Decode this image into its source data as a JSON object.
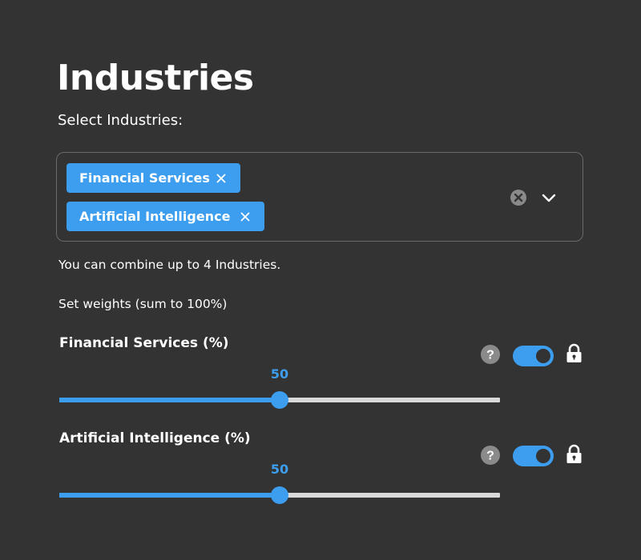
{
  "header": {
    "title": "Industries",
    "select_label": "Select Industries:"
  },
  "multiselect": {
    "chips": [
      {
        "label": "Financial Services"
      },
      {
        "label": "Artificial Intelligence"
      }
    ],
    "hint": "You can combine up to 4 Industries."
  },
  "weights": {
    "label": "Set weights (sum to 100%)",
    "sliders": [
      {
        "title": "Financial Services (%)",
        "value": "50",
        "min": 0,
        "max": 100,
        "toggle_on": true,
        "locked": true
      },
      {
        "title": "Artificial Intelligence (%)",
        "value": "50",
        "min": 0,
        "max": 100,
        "toggle_on": true,
        "locked": true
      }
    ]
  },
  "icons": {
    "chip_remove": "close-icon",
    "clear": "clear-circle-icon",
    "dropdown": "chevron-down-icon",
    "help": "question-circle-icon",
    "lock": "lock-icon"
  },
  "colors": {
    "background": "#333333",
    "accent": "#3d9ef0",
    "track": "#d9d9d9",
    "border": "#6a6a6a",
    "icon_gray": "#8a8a8a"
  }
}
